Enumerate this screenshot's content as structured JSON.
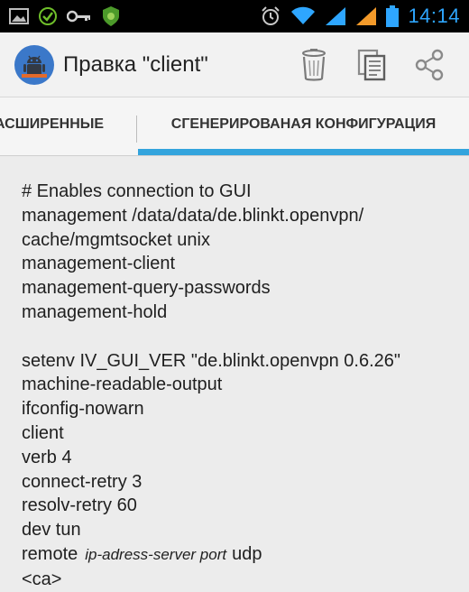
{
  "status_bar": {
    "left_icons": [
      "gallery-icon",
      "check-circle-icon",
      "key-icon",
      "android-shield-icon"
    ],
    "right_icons": [
      "alarm-icon",
      "wifi-icon",
      "signal-icon-1",
      "signal-icon-2",
      "battery-icon"
    ],
    "time": "14:14",
    "clock_color": "#2ea6ff"
  },
  "action_bar": {
    "title": "Правка \"client\"",
    "actions": [
      "delete",
      "copy",
      "share"
    ]
  },
  "tabs": [
    {
      "label": "РАСШИРЕННЫЕ",
      "visible_text": "АСШИРЕННЫЕ",
      "selected": false
    },
    {
      "label": "СГЕНЕРИРОВАНАЯ КОНФИГУРАЦИЯ",
      "selected": true
    }
  ],
  "accent_color": "#33a4dd",
  "config": {
    "lines": [
      "# Enables connection to GUI",
      "management /data/data/de.blinkt.openvpn/",
      "cache/mgmtsocket unix",
      "management-client",
      "management-query-passwords",
      "management-hold",
      "",
      "setenv IV_GUI_VER \"de.blinkt.openvpn 0.6.26\"",
      "machine-readable-output",
      "ifconfig-nowarn",
      "client",
      "verb 4",
      "connect-retry 3",
      "resolv-retry 60",
      "dev tun"
    ],
    "remote": {
      "keyword": "remote",
      "placeholder": "ip-adress-server port",
      "protocol": "udp"
    },
    "last_line": "<ca>"
  }
}
